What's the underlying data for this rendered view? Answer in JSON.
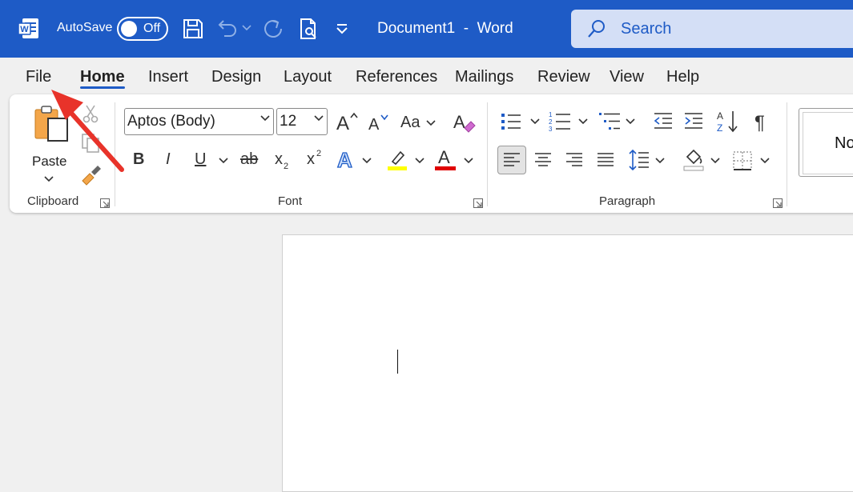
{
  "titlebar": {
    "autosave_label": "AutoSave",
    "autosave_state": "Off",
    "document_title": "Document1  -  Word",
    "search_placeholder": "Search",
    "icons": [
      "word-logo-icon",
      "save-icon",
      "undo-icon",
      "redo-icon",
      "print-preview-icon",
      "customize-toolbar-icon",
      "search-icon"
    ]
  },
  "menu": {
    "tabs": [
      "File",
      "Home",
      "Insert",
      "Design",
      "Layout",
      "References",
      "Mailings",
      "Review",
      "View",
      "Help"
    ],
    "active": "Home"
  },
  "ribbon": {
    "clipboard": {
      "paste_label": "Paste",
      "group_label": "Clipboard"
    },
    "font": {
      "font_name": "Aptos (Body)",
      "font_size": "12",
      "change_case_label": "Aa",
      "bold": "B",
      "italic": "I",
      "underline": "U",
      "strikethrough": "ab",
      "subscript": "x",
      "superscript": "x",
      "text_effects": "A",
      "font_color": "A",
      "group_label": "Font"
    },
    "paragraph": {
      "group_label": "Paragraph"
    },
    "styles": {
      "first_style_partial": "No"
    }
  },
  "colors": {
    "titlebar": "#1e5bc6",
    "highlight": "#ffff00",
    "font_color": "#e00000",
    "annotation_arrow": "#e8332a"
  }
}
